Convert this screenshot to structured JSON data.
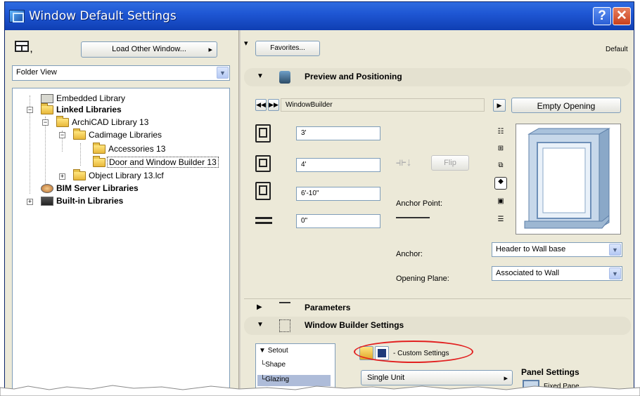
{
  "window": {
    "title": "Window Default Settings"
  },
  "left": {
    "load_button": "Load Other Window...",
    "view_select": "Folder View",
    "tree": [
      {
        "label": "Embedded Library",
        "bold": false
      },
      {
        "label": "Linked Libraries",
        "bold": true
      },
      {
        "label": "ArchiCAD Library 13",
        "bold": false
      },
      {
        "label": "Cadimage Libraries",
        "bold": false
      },
      {
        "label": "Accessories 13",
        "bold": false
      },
      {
        "label": "Door and Window Builder 13",
        "bold": false,
        "selected": true
      },
      {
        "label": "Object Library 13.lcf",
        "bold": false
      },
      {
        "label": "BIM Server Libraries",
        "bold": true
      },
      {
        "label": "Built-in Libraries",
        "bold": true
      }
    ]
  },
  "right": {
    "favorites_button": "Favorites...",
    "default_label": "Default",
    "preview_section_title": "Preview and Positioning",
    "object_name": "WindowBuilder",
    "empty_opening_button": "Empty Opening",
    "dims": {
      "width": "3'",
      "height": "4'",
      "sill": "6'-10\"",
      "offset": "0\""
    },
    "flip_button": "Flip",
    "anchor_point_label": "Anchor Point:",
    "anchor_label": "Anchor:",
    "anchor_value": "Header to Wall base",
    "opening_plane_label": "Opening Plane:",
    "opening_plane_value": "Associated to Wall",
    "parameters_title": "Parameters",
    "builder_title": "Window Builder Settings",
    "setout_tree": [
      "Setout",
      "Shape",
      "Glazing"
    ],
    "custom_settings": "- Custom Settings",
    "single_unit": "Single Unit",
    "panel_settings_label": "Panel Settings",
    "fixed_pane_label": "Fixed Pane"
  },
  "colors": {
    "title_bar": "#1f57d4",
    "highlight": "#e22020",
    "dialog_bg": "#ece9d8"
  }
}
